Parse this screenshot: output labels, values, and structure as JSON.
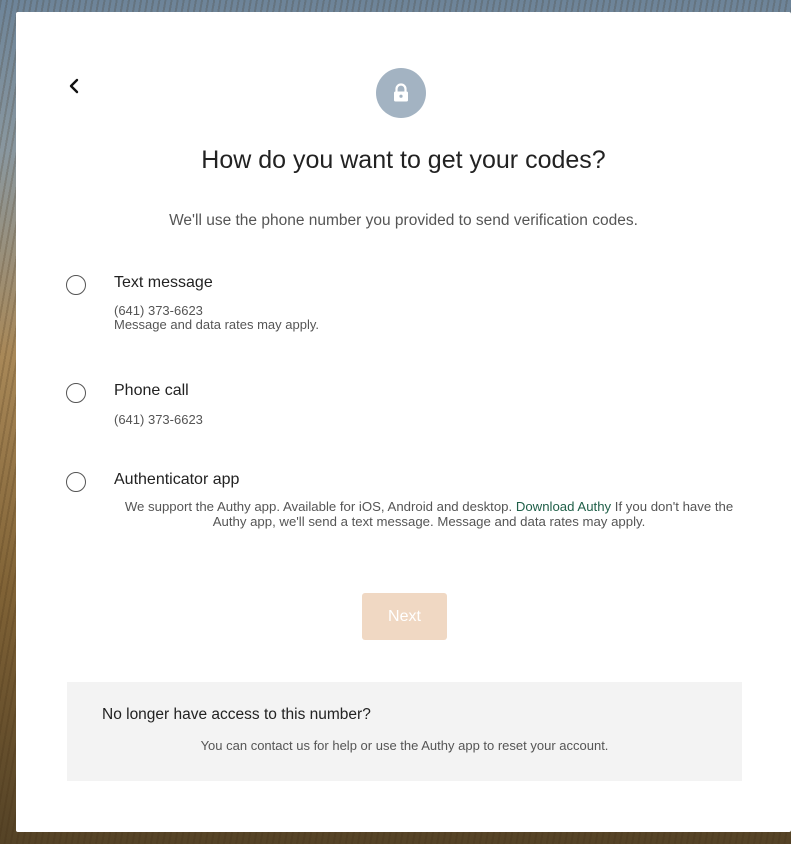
{
  "header": {
    "back_icon": "chevron-left-icon",
    "lock_icon": "lock-icon",
    "title": "How do you want to get your codes?",
    "subtitle": "We'll use the phone number you provided to send verification codes."
  },
  "options": [
    {
      "label": "Text message",
      "phone": "(641) 373-6623",
      "note": "Message and data rates may apply."
    },
    {
      "label": "Phone call",
      "phone": "(641) 373-6623"
    },
    {
      "label": "Authenticator app",
      "desc_before": "We support the Authy app. Available for iOS, Android and desktop. ",
      "link": "Download Authy",
      "desc_after": " If you don't have the Authy app, we'll send a text message. Message and data rates may apply."
    }
  ],
  "next_button": {
    "label": "Next",
    "color": "#f0d8c3"
  },
  "help": {
    "title": "No longer have access to this number?",
    "text": "You can contact us for help or use the Authy app to reset your account."
  },
  "colors": {
    "lock_circle": "#a3b3c2",
    "link": "#1f5f48"
  }
}
